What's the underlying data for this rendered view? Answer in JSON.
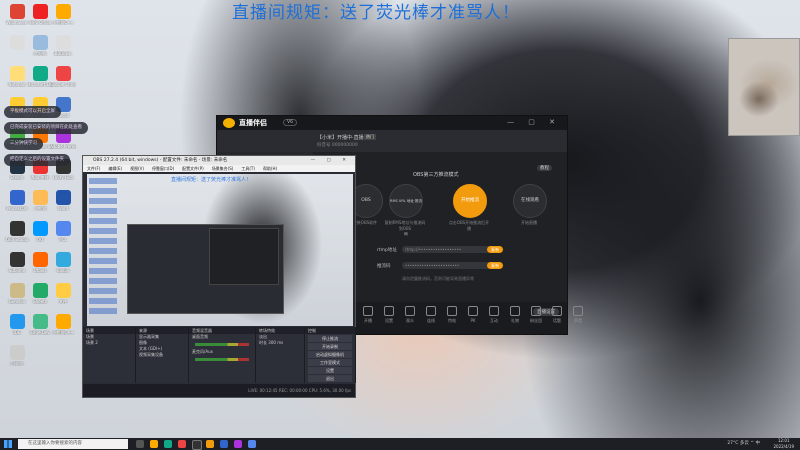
{
  "banner": "直播间规矩：送了荧光棒才准骂人！",
  "desktop_icons": [
    {
      "label": "Wallhaven",
      "color": "#d43"
    },
    {
      "label": "WPS Office",
      "color": "#e22"
    },
    {
      "label": "小熊猫C++",
      "color": "#fa0"
    },
    {
      "label": "",
      "color": "#ddd"
    },
    {
      "label": "此电脑",
      "color": "#9bd"
    },
    {
      "label": "BBDown",
      "color": "#ddd"
    },
    {
      "label": "Notepad",
      "color": "#fd7"
    },
    {
      "label": "Microsoft Edge",
      "color": "#1a8"
    },
    {
      "label": "Google Chrome",
      "color": "#e44"
    },
    {
      "label": "快捷键",
      "color": "#fc3"
    },
    {
      "label": "ExifTool",
      "color": "#fc3"
    },
    {
      "label": "Recall",
      "color": "#47c"
    },
    {
      "label": "GeForce Experience",
      "color": "#4a4"
    },
    {
      "label": "Wallpaper Engine",
      "color": "#f70"
    },
    {
      "label": "Adobe Premiere",
      "color": "#a3d"
    },
    {
      "label": "Steam",
      "color": "#234"
    },
    {
      "label": "Nox 夜神",
      "color": "#e33"
    },
    {
      "label": "Unity Hub",
      "color": "#333"
    },
    {
      "label": "ProcessOn",
      "color": "#36c"
    },
    {
      "label": "小熊猫",
      "color": "#fb5"
    },
    {
      "label": "Word",
      "color": "#25a"
    },
    {
      "label": "OBS Studio",
      "color": "#333"
    },
    {
      "label": "QQ",
      "color": "#09f"
    },
    {
      "label": "PCL",
      "color": "#58e"
    },
    {
      "label": "Sublime",
      "color": "#333"
    },
    {
      "label": "Utools",
      "color": "#f60"
    },
    {
      "label": "Bilibili",
      "color": "#3ad"
    },
    {
      "label": "Genshin",
      "color": "#cb8"
    },
    {
      "label": "Sheets",
      "color": "#2a6"
    },
    {
      "label": "文件",
      "color": "#fc4"
    },
    {
      "label": "IDE",
      "color": "#29e"
    },
    {
      "label": "Edge Dev",
      "color": "#4b8"
    },
    {
      "label": "小熊猫C++",
      "color": "#fa0"
    },
    {
      "label": "回收站",
      "color": "#ccc"
    }
  ],
  "notes": [
    "平板模式可以开启全屏",
    "已完成安装已安装的项目在此处查看",
    "三分钟快学习",
    "把自定义之后的设置文件夹"
  ],
  "live_app": {
    "brand": "直播伴侣",
    "version": "V6",
    "room_title": "【小米】开播中·直播",
    "room_sub": "抖音号 000000000",
    "hot_label": "热门",
    "mode_title": "OBS第三方推流模式",
    "tutorial": "教程",
    "steps": [
      {
        "label": "OBS",
        "caption": "安装OBS软件"
      },
      {
        "label": "RMS URL 地址·推流码",
        "caption": "复制RMS地址与推流码到OBS"
      },
      {
        "label": "开始推流",
        "caption": "点击OBS开始推流后开播"
      },
      {
        "label": "在线观看",
        "caption": "开始直播"
      }
    ],
    "server_label": "rtmp地址",
    "server_value": "rtmp://••••••••••••••••••",
    "key_label": "推流码",
    "key_value": "•••••••••••••••••••••••",
    "copy_label": "复制",
    "warning": "请勿泄露推流码，否则可能导致直播异常",
    "toolbar": [
      "开播",
      "设置",
      "观众",
      "连线",
      "特效",
      "PK",
      "互动",
      "礼物",
      "粉丝团",
      "话题",
      "声音"
    ],
    "settings_label": "直播设置",
    "window_buttons": "— ▢ ✕"
  },
  "obs": {
    "title": "OBS 27.2.4 (64 bit, windows) - 配置文件: 未命名 - 场景: 未命名",
    "menu": [
      "文件(F)",
      "编辑(E)",
      "视图(V)",
      "停靠窗口(D)",
      "配置文件(P)",
      "场景集合(S)",
      "工具(T)",
      "帮助(H)"
    ],
    "preview_banner": "直播间规矩：送了荧光棒才准骂人！",
    "docks": {
      "scenes": {
        "title": "场景",
        "items": [
          "场景",
          "场景 2"
        ]
      },
      "sources": {
        "title": "来源",
        "items": [
          "显示器采集",
          "图像",
          "文本 (GDI+)",
          "视频采集设备"
        ]
      },
      "mixer": {
        "title": "音频混音器",
        "items": [
          "桌面音频",
          "麦克风/Aux"
        ]
      },
      "transitions": {
        "title": "转场特效",
        "fade": "淡出",
        "duration_label": "时长",
        "duration_value": "300 ms"
      },
      "controls": {
        "title": "控制",
        "buttons": [
          "停止推流",
          "开始录制",
          "启动虚拟摄像机",
          "工作室模式",
          "设置",
          "退出"
        ]
      }
    },
    "status": "LIVE: 00:12:45  REC: 00:00:00  CPU: 5.6%, 30.00 fps"
  },
  "taskbar": {
    "search_placeholder": "在这里输入你要搜索的内容",
    "tray": "27°C 多云 ^ 中",
    "time": "12:01",
    "date": "2022/4/19"
  }
}
